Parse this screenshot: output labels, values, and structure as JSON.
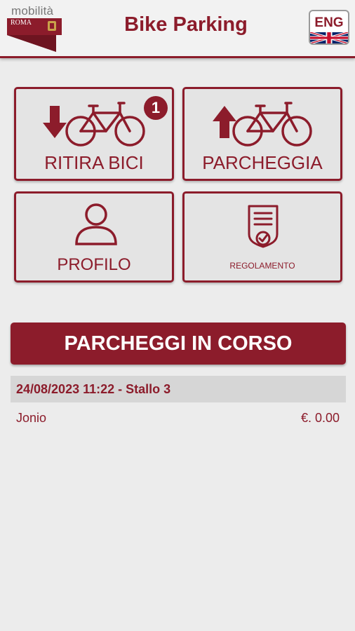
{
  "header": {
    "logo_text": "mobilità",
    "logo_sub": "ROMA",
    "title": "Bike Parking",
    "language_label": "ENG"
  },
  "tiles": [
    {
      "label": "RITIRA BICI",
      "icon": "bike-down-icon",
      "badge": "1"
    },
    {
      "label": "PARCHEGGIA",
      "icon": "bike-up-icon"
    },
    {
      "label": "PROFILO",
      "icon": "user-icon"
    },
    {
      "label": "REGOLAMENTO",
      "icon": "regulation-document-icon"
    }
  ],
  "section": {
    "label": "PARCHEGGI IN CORSO"
  },
  "parkings": [
    {
      "header": "24/08/2023 11:22 - Stallo 3",
      "name": "Jonio",
      "price": "€. 0.00"
    }
  ],
  "colors": {
    "brand": "#8c1c2b",
    "background": "#ececec",
    "tile_background": "#e4e4e4"
  }
}
